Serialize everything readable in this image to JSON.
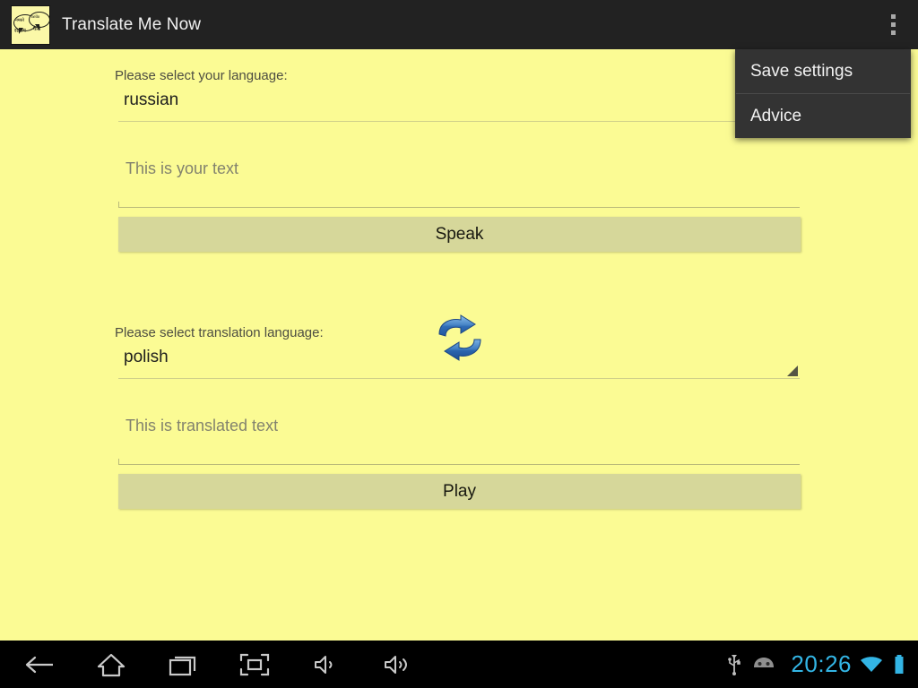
{
  "app": {
    "title": "Translate Me Now",
    "icon_name": "speech-bubbles-app-icon",
    "bubble_texts": {
      "left_top": "नमस्ते",
      "right_top": "hello",
      "left_bottom": "सलाम",
      "right_bottom": "कैसे"
    }
  },
  "overflow_menu": {
    "trigger_name": "overflow-menu-button",
    "items": [
      {
        "label": "Save settings"
      },
      {
        "label": "Advice"
      }
    ]
  },
  "form": {
    "source_language_label": "Please select your language:",
    "source_language_value": "russian",
    "source_text_placeholder": "This is your text",
    "source_text_value": "",
    "speak_button_label": "Speak",
    "swap_icon_name": "swap-languages-icon",
    "target_language_label": "Please select translation language:",
    "target_language_value": "polish",
    "target_text_placeholder": "This is translated text",
    "target_text_value": "",
    "play_button_label": "Play"
  },
  "navbar": {
    "buttons": [
      {
        "name": "back-icon"
      },
      {
        "name": "home-icon"
      },
      {
        "name": "recents-icon"
      },
      {
        "name": "screenshot-icon"
      },
      {
        "name": "volume-down-icon"
      },
      {
        "name": "volume-up-icon"
      }
    ],
    "status": {
      "usb_icon": "usb-icon",
      "adb_icon": "android-debug-icon",
      "clock": "20:26",
      "wifi_icon": "wifi-icon",
      "battery_icon": "battery-icon"
    }
  },
  "colors": {
    "background": "#fbfb94",
    "action_bar": "#222222",
    "menu_background": "#333333",
    "button": "#d6d79a",
    "clock_accent": "#33b5e5",
    "swap_arrow": "#2f6cb5"
  }
}
